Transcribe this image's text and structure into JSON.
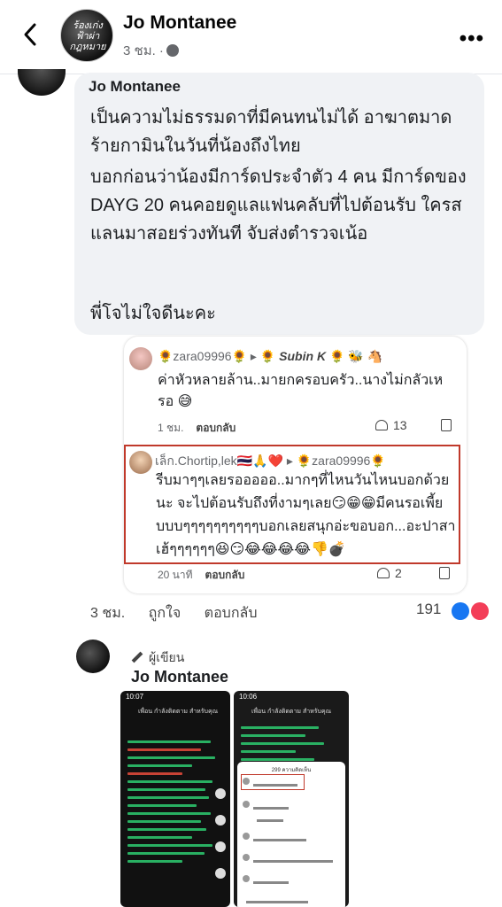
{
  "header": {
    "name": "Jo Montanee",
    "time": "3 ชม. ·",
    "avatar_text": "ร้องเก่ง ฟ้าผ่า กฎหมาย",
    "more_label": "•••"
  },
  "main_comment": {
    "author": "Jo Montanee",
    "paragraph1": "เป็นความไม่ธรรมดาที่มีคนทนไม่ได้ อาฆาตมาดร้ายกามินในวันที่น้องถึงไทย",
    "paragraph2": "บอกก่อนว่าน้องมีการ์ดประจำตัว 4 คน  มีการ์ดของ DAYG 20 คนคอยดูแลแฟนคลับที่ไปต้อนรับ ใครสแลนมาสอยร่วงทันที จับส่งตำรวจเน้อ",
    "paragraph3": "พี่โจไม่ใจดีนะคะ"
  },
  "reply1": {
    "names": "🌻zara09996🌻 ▸ 🌻",
    "tagged": "Subin K",
    "tagged_suffix": "🌻 🐝 🐴",
    "text": "ค่าหัวหลายล้าน..มายกครอบครัว..นางไม่กลัวเหรอ 😅",
    "time": "1 ชม.",
    "reply_label": "ตอบกลับ",
    "likes": "13"
  },
  "reply2": {
    "names": "เล็ก.Chortip,lek🇹🇭🙏❤️ ▸ 🌻zara09996🌻",
    "text": "รีบมาๆๆเลยรอออออ..มากๆที่ไหนวันไหนบอกด้วยนะ จะไปต้อนรับถึงที่งามๆเลย😏😁😁มีคนรอเพี้ยบบบๆๆๆๆๆๆๆๆๆๆบอกเลยสนุกอ่ะขอบอก...อะปาสาเฮ้ๆๆๆๆๆๆ😆😏😂😂😂😂👎💣",
    "time": "20 นาที",
    "reply_label": "ตอบกลับ",
    "likes": "2"
  },
  "main_actions": {
    "time": "3 ชม.",
    "like_label": "ถูกใจ",
    "reply_label": "ตอบกลับ",
    "reaction_count": "191"
  },
  "author_reply": {
    "badge": "ผู้เขียน",
    "name": "Jo Montanee"
  },
  "screenshot1": {
    "status": "10:07",
    "tabs": "เพื่อน  กำลังติดตาม  สำหรับคุณ"
  },
  "screenshot2": {
    "status": "10:06",
    "tabs": "เพื่อน  กำลังติดตาม  สำหรับคุณ",
    "panel_title": "299 ความคิดเห็น"
  },
  "colors": {
    "highlight_box": "#c0392b",
    "like_blue": "#1877f2",
    "love_red": "#f33e58"
  }
}
